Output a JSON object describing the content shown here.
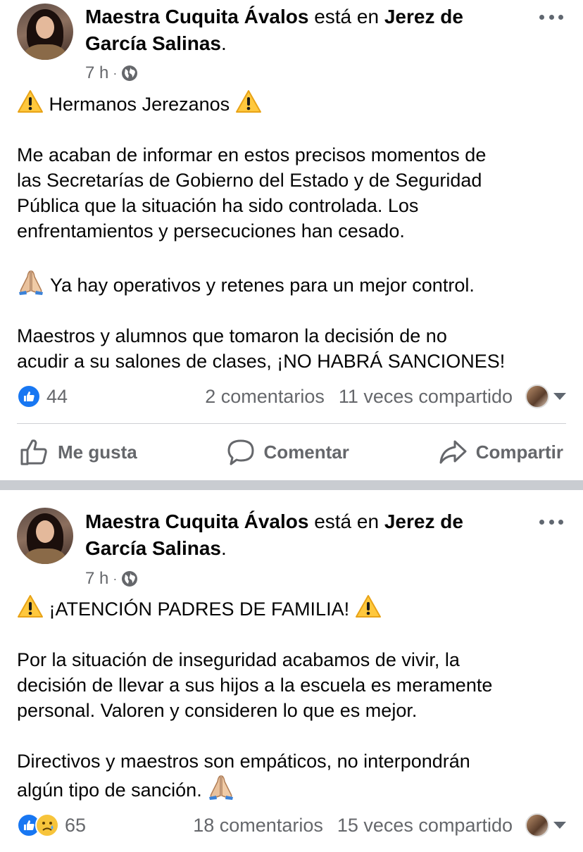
{
  "posts": [
    {
      "author": "Maestra Cuquita Ávalos",
      "location_connector": "está en",
      "location_line1": "Jerez de",
      "location_line2": "García Salinas",
      "location_suffix": ".",
      "time": "7 h",
      "dot": "·",
      "privacy_icon": "globe-icon",
      "title": "Hermanos Jerezanos",
      "title_emoji": "warning-emoji",
      "paragraphs": [
        [
          "Me acaban de informar en estos precisos momentos de",
          "las Secretarías de Gobierno del Estado y de Seguridad",
          "Pública que la situación ha sido controlada. Los",
          "enfrentamientos y persecuciones han cesado."
        ],
        [
          "Ya hay operativos y retenes para un mejor control."
        ],
        [
          "Maestros y alumnos que tomaron la decisión de no",
          "acudir a su salones de clases, ¡NO HABRÁ SANCIONES!"
        ]
      ],
      "reactions_count": "44",
      "reaction_types": [
        "like"
      ],
      "comments": "2 comentarios",
      "shares": "11 veces compartido",
      "actions": {
        "like": "Me gusta",
        "comment": "Comentar",
        "share": "Compartir"
      }
    },
    {
      "author": "Maestra Cuquita Ávalos",
      "location_connector": "está en",
      "location_line1": "Jerez de",
      "location_line2": "García Salinas",
      "location_suffix": ".",
      "time": "7 h",
      "dot": "·",
      "privacy_icon": "globe-icon",
      "title": "¡ATENCIÓN PADRES DE FAMILIA!",
      "title_emoji": "warning-emoji",
      "paragraphs": [
        [
          "Por la situación de inseguridad acabamos de vivir, la",
          "decisión de llevar a sus hijos a la escuela es meramente",
          "personal. Valoren y consideren lo que es mejor."
        ],
        [
          "Directivos y maestros son empáticos, no interpondrán",
          "algún tipo de sanción."
        ]
      ],
      "reactions_count": "65",
      "reaction_types": [
        "like",
        "sad"
      ],
      "comments": "18 comentarios",
      "shares": "15 veces compartido"
    }
  ],
  "colors": {
    "like_blue": "#1877f2",
    "muted_text": "#65676b",
    "divider": "#c9ccd1",
    "warning_yellow": "#ffc83d"
  }
}
